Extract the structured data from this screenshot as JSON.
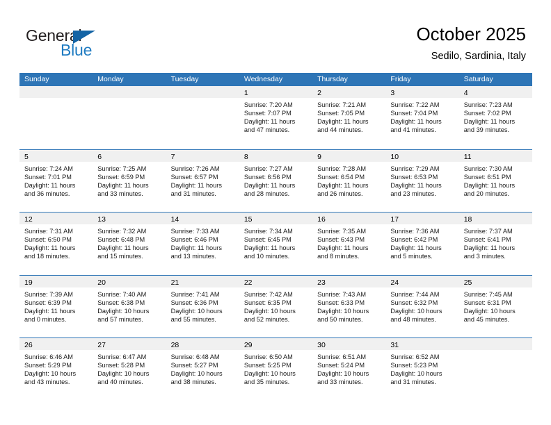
{
  "brand": {
    "name_part1": "General",
    "name_part2": "Blue",
    "logo_icon": "triangle-icon",
    "accent_color": "#1464a5",
    "blue_text_color": "#1f7bc1"
  },
  "header": {
    "title": "October 2025",
    "subtitle": "Sedilo, Sardinia, Italy"
  },
  "calendar": {
    "header_bg": "#2e75b6",
    "day_band_bg": "#f0f0f0",
    "weekdays": [
      "Sunday",
      "Monday",
      "Tuesday",
      "Wednesday",
      "Thursday",
      "Friday",
      "Saturday"
    ],
    "weeks": [
      [
        {
          "day": "",
          "lines": []
        },
        {
          "day": "",
          "lines": []
        },
        {
          "day": "",
          "lines": []
        },
        {
          "day": "1",
          "lines": [
            "Sunrise: 7:20 AM",
            "Sunset: 7:07 PM",
            "Daylight: 11 hours",
            "and 47 minutes."
          ]
        },
        {
          "day": "2",
          "lines": [
            "Sunrise: 7:21 AM",
            "Sunset: 7:05 PM",
            "Daylight: 11 hours",
            "and 44 minutes."
          ]
        },
        {
          "day": "3",
          "lines": [
            "Sunrise: 7:22 AM",
            "Sunset: 7:04 PM",
            "Daylight: 11 hours",
            "and 41 minutes."
          ]
        },
        {
          "day": "4",
          "lines": [
            "Sunrise: 7:23 AM",
            "Sunset: 7:02 PM",
            "Daylight: 11 hours",
            "and 39 minutes."
          ]
        }
      ],
      [
        {
          "day": "5",
          "lines": [
            "Sunrise: 7:24 AM",
            "Sunset: 7:01 PM",
            "Daylight: 11 hours",
            "and 36 minutes."
          ]
        },
        {
          "day": "6",
          "lines": [
            "Sunrise: 7:25 AM",
            "Sunset: 6:59 PM",
            "Daylight: 11 hours",
            "and 33 minutes."
          ]
        },
        {
          "day": "7",
          "lines": [
            "Sunrise: 7:26 AM",
            "Sunset: 6:57 PM",
            "Daylight: 11 hours",
            "and 31 minutes."
          ]
        },
        {
          "day": "8",
          "lines": [
            "Sunrise: 7:27 AM",
            "Sunset: 6:56 PM",
            "Daylight: 11 hours",
            "and 28 minutes."
          ]
        },
        {
          "day": "9",
          "lines": [
            "Sunrise: 7:28 AM",
            "Sunset: 6:54 PM",
            "Daylight: 11 hours",
            "and 26 minutes."
          ]
        },
        {
          "day": "10",
          "lines": [
            "Sunrise: 7:29 AM",
            "Sunset: 6:53 PM",
            "Daylight: 11 hours",
            "and 23 minutes."
          ]
        },
        {
          "day": "11",
          "lines": [
            "Sunrise: 7:30 AM",
            "Sunset: 6:51 PM",
            "Daylight: 11 hours",
            "and 20 minutes."
          ]
        }
      ],
      [
        {
          "day": "12",
          "lines": [
            "Sunrise: 7:31 AM",
            "Sunset: 6:50 PM",
            "Daylight: 11 hours",
            "and 18 minutes."
          ]
        },
        {
          "day": "13",
          "lines": [
            "Sunrise: 7:32 AM",
            "Sunset: 6:48 PM",
            "Daylight: 11 hours",
            "and 15 minutes."
          ]
        },
        {
          "day": "14",
          "lines": [
            "Sunrise: 7:33 AM",
            "Sunset: 6:46 PM",
            "Daylight: 11 hours",
            "and 13 minutes."
          ]
        },
        {
          "day": "15",
          "lines": [
            "Sunrise: 7:34 AM",
            "Sunset: 6:45 PM",
            "Daylight: 11 hours",
            "and 10 minutes."
          ]
        },
        {
          "day": "16",
          "lines": [
            "Sunrise: 7:35 AM",
            "Sunset: 6:43 PM",
            "Daylight: 11 hours",
            "and 8 minutes."
          ]
        },
        {
          "day": "17",
          "lines": [
            "Sunrise: 7:36 AM",
            "Sunset: 6:42 PM",
            "Daylight: 11 hours",
            "and 5 minutes."
          ]
        },
        {
          "day": "18",
          "lines": [
            "Sunrise: 7:37 AM",
            "Sunset: 6:41 PM",
            "Daylight: 11 hours",
            "and 3 minutes."
          ]
        }
      ],
      [
        {
          "day": "19",
          "lines": [
            "Sunrise: 7:39 AM",
            "Sunset: 6:39 PM",
            "Daylight: 11 hours",
            "and 0 minutes."
          ]
        },
        {
          "day": "20",
          "lines": [
            "Sunrise: 7:40 AM",
            "Sunset: 6:38 PM",
            "Daylight: 10 hours",
            "and 57 minutes."
          ]
        },
        {
          "day": "21",
          "lines": [
            "Sunrise: 7:41 AM",
            "Sunset: 6:36 PM",
            "Daylight: 10 hours",
            "and 55 minutes."
          ]
        },
        {
          "day": "22",
          "lines": [
            "Sunrise: 7:42 AM",
            "Sunset: 6:35 PM",
            "Daylight: 10 hours",
            "and 52 minutes."
          ]
        },
        {
          "day": "23",
          "lines": [
            "Sunrise: 7:43 AM",
            "Sunset: 6:33 PM",
            "Daylight: 10 hours",
            "and 50 minutes."
          ]
        },
        {
          "day": "24",
          "lines": [
            "Sunrise: 7:44 AM",
            "Sunset: 6:32 PM",
            "Daylight: 10 hours",
            "and 48 minutes."
          ]
        },
        {
          "day": "25",
          "lines": [
            "Sunrise: 7:45 AM",
            "Sunset: 6:31 PM",
            "Daylight: 10 hours",
            "and 45 minutes."
          ]
        }
      ],
      [
        {
          "day": "26",
          "lines": [
            "Sunrise: 6:46 AM",
            "Sunset: 5:29 PM",
            "Daylight: 10 hours",
            "and 43 minutes."
          ]
        },
        {
          "day": "27",
          "lines": [
            "Sunrise: 6:47 AM",
            "Sunset: 5:28 PM",
            "Daylight: 10 hours",
            "and 40 minutes."
          ]
        },
        {
          "day": "28",
          "lines": [
            "Sunrise: 6:48 AM",
            "Sunset: 5:27 PM",
            "Daylight: 10 hours",
            "and 38 minutes."
          ]
        },
        {
          "day": "29",
          "lines": [
            "Sunrise: 6:50 AM",
            "Sunset: 5:25 PM",
            "Daylight: 10 hours",
            "and 35 minutes."
          ]
        },
        {
          "day": "30",
          "lines": [
            "Sunrise: 6:51 AM",
            "Sunset: 5:24 PM",
            "Daylight: 10 hours",
            "and 33 minutes."
          ]
        },
        {
          "day": "31",
          "lines": [
            "Sunrise: 6:52 AM",
            "Sunset: 5:23 PM",
            "Daylight: 10 hours",
            "and 31 minutes."
          ]
        },
        {
          "day": "",
          "lines": []
        }
      ]
    ]
  }
}
